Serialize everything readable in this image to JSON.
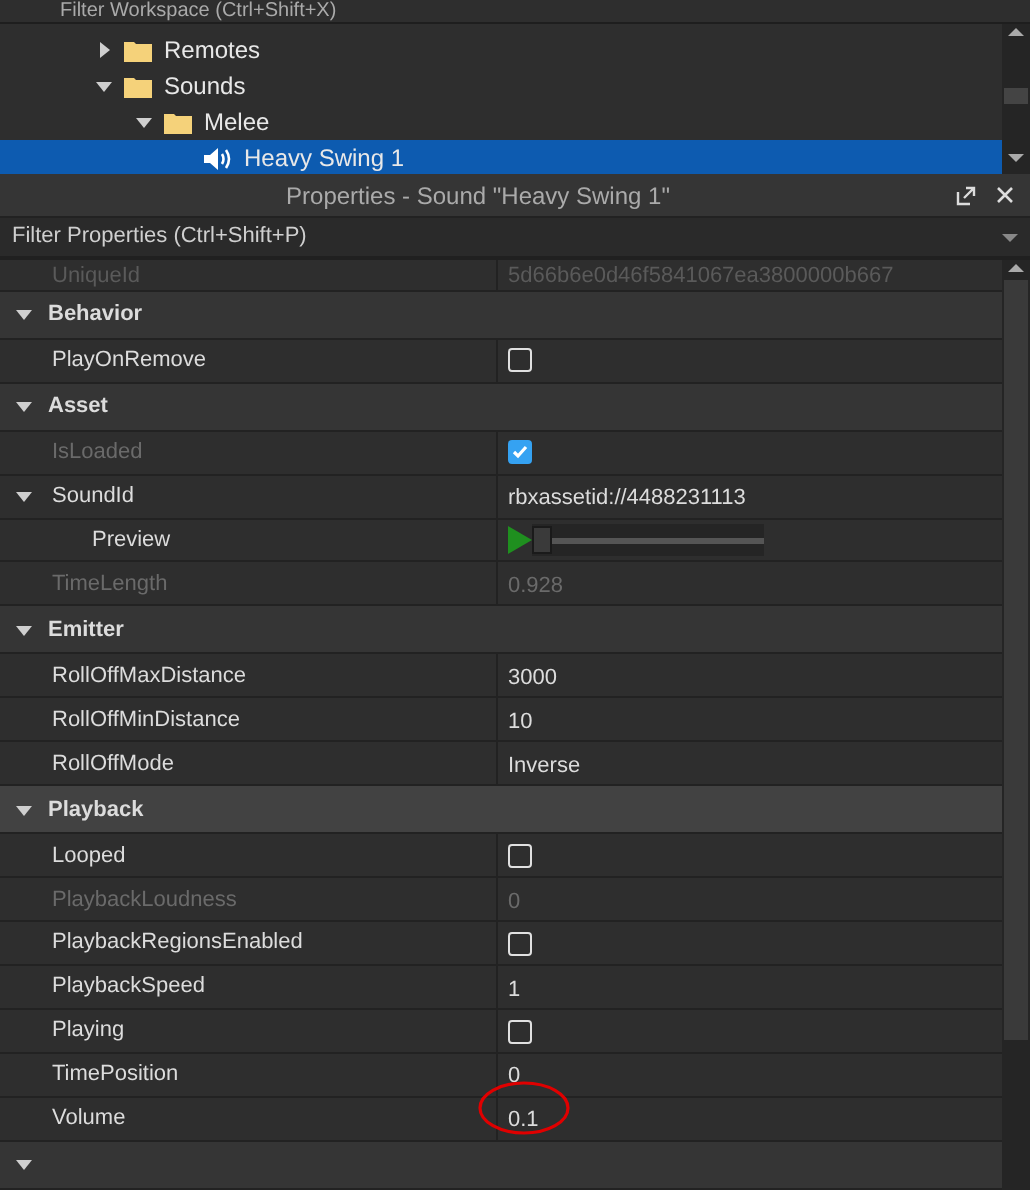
{
  "explorer": {
    "filter": {
      "placeholder": "Filter Workspace (Ctrl+Shift+X)"
    },
    "tree": [
      {
        "name": "Remotes",
        "kind": "folder",
        "expanded": false,
        "selected": false
      },
      {
        "name": "Sounds",
        "kind": "folder",
        "expanded": true,
        "selected": false,
        "children": [
          {
            "name": "Melee",
            "kind": "folder",
            "expanded": true,
            "selected": false,
            "children": [
              {
                "name": "Heavy Swing 1",
                "kind": "sound",
                "selected": true
              }
            ]
          }
        ]
      }
    ]
  },
  "properties": {
    "title": "Properties - Sound \"Heavy Swing 1\"",
    "filter": {
      "placeholder": "Filter Properties (Ctrl+Shift+P)"
    },
    "rows": [
      {
        "name": "UniqueId",
        "value": "5d66b6e0d46f5841067ea3800000b667",
        "disabled": true
      }
    ],
    "groups": [
      {
        "name": "Behavior",
        "expanded": true,
        "hovered": false,
        "rows": [
          {
            "kind": "checkbox",
            "name": "PlayOnRemove",
            "checked": false,
            "disabled": false
          }
        ]
      },
      {
        "name": "Asset",
        "expanded": true,
        "hovered": false,
        "rows": [
          {
            "kind": "checkbox",
            "name": "IsLoaded",
            "checked": true,
            "disabled": true
          },
          {
            "kind": "text",
            "name": "SoundId",
            "value": "rbxassetid://4488231113",
            "disabled": false,
            "expanded": true,
            "children": [
              {
                "kind": "preview",
                "name": "Preview",
                "level": 0,
                "disabled": false
              }
            ]
          },
          {
            "kind": "text",
            "name": "TimeLength",
            "value": "0.928",
            "disabled": true
          }
        ]
      },
      {
        "name": "Emitter",
        "expanded": true,
        "hovered": false,
        "rows": [
          {
            "kind": "text",
            "name": "RollOffMaxDistance",
            "value": "3000",
            "disabled": false
          },
          {
            "kind": "text",
            "name": "RollOffMinDistance",
            "value": "10",
            "disabled": false
          },
          {
            "kind": "text",
            "name": "RollOffMode",
            "value": "Inverse",
            "disabled": false
          }
        ]
      },
      {
        "name": "Playback",
        "expanded": true,
        "hovered": true,
        "rows": [
          {
            "kind": "checkbox",
            "name": "Looped",
            "checked": false,
            "disabled": false
          },
          {
            "kind": "text",
            "name": "PlaybackLoudness",
            "value": "0",
            "disabled": true
          },
          {
            "kind": "checkbox",
            "name": "PlaybackRegionsEnabled",
            "checked": false,
            "disabled": false
          },
          {
            "kind": "text",
            "name": "PlaybackSpeed",
            "value": "1",
            "disabled": false
          },
          {
            "kind": "checkbox",
            "name": "Playing",
            "checked": false,
            "disabled": false
          },
          {
            "kind": "text",
            "name": "TimePosition",
            "value": "0",
            "disabled": false
          },
          {
            "kind": "text",
            "name": "Volume",
            "value": "0.1",
            "disabled": false,
            "annotated": true
          }
        ]
      },
      {
        "expanded": true,
        "hovered": false
      }
    ]
  }
}
